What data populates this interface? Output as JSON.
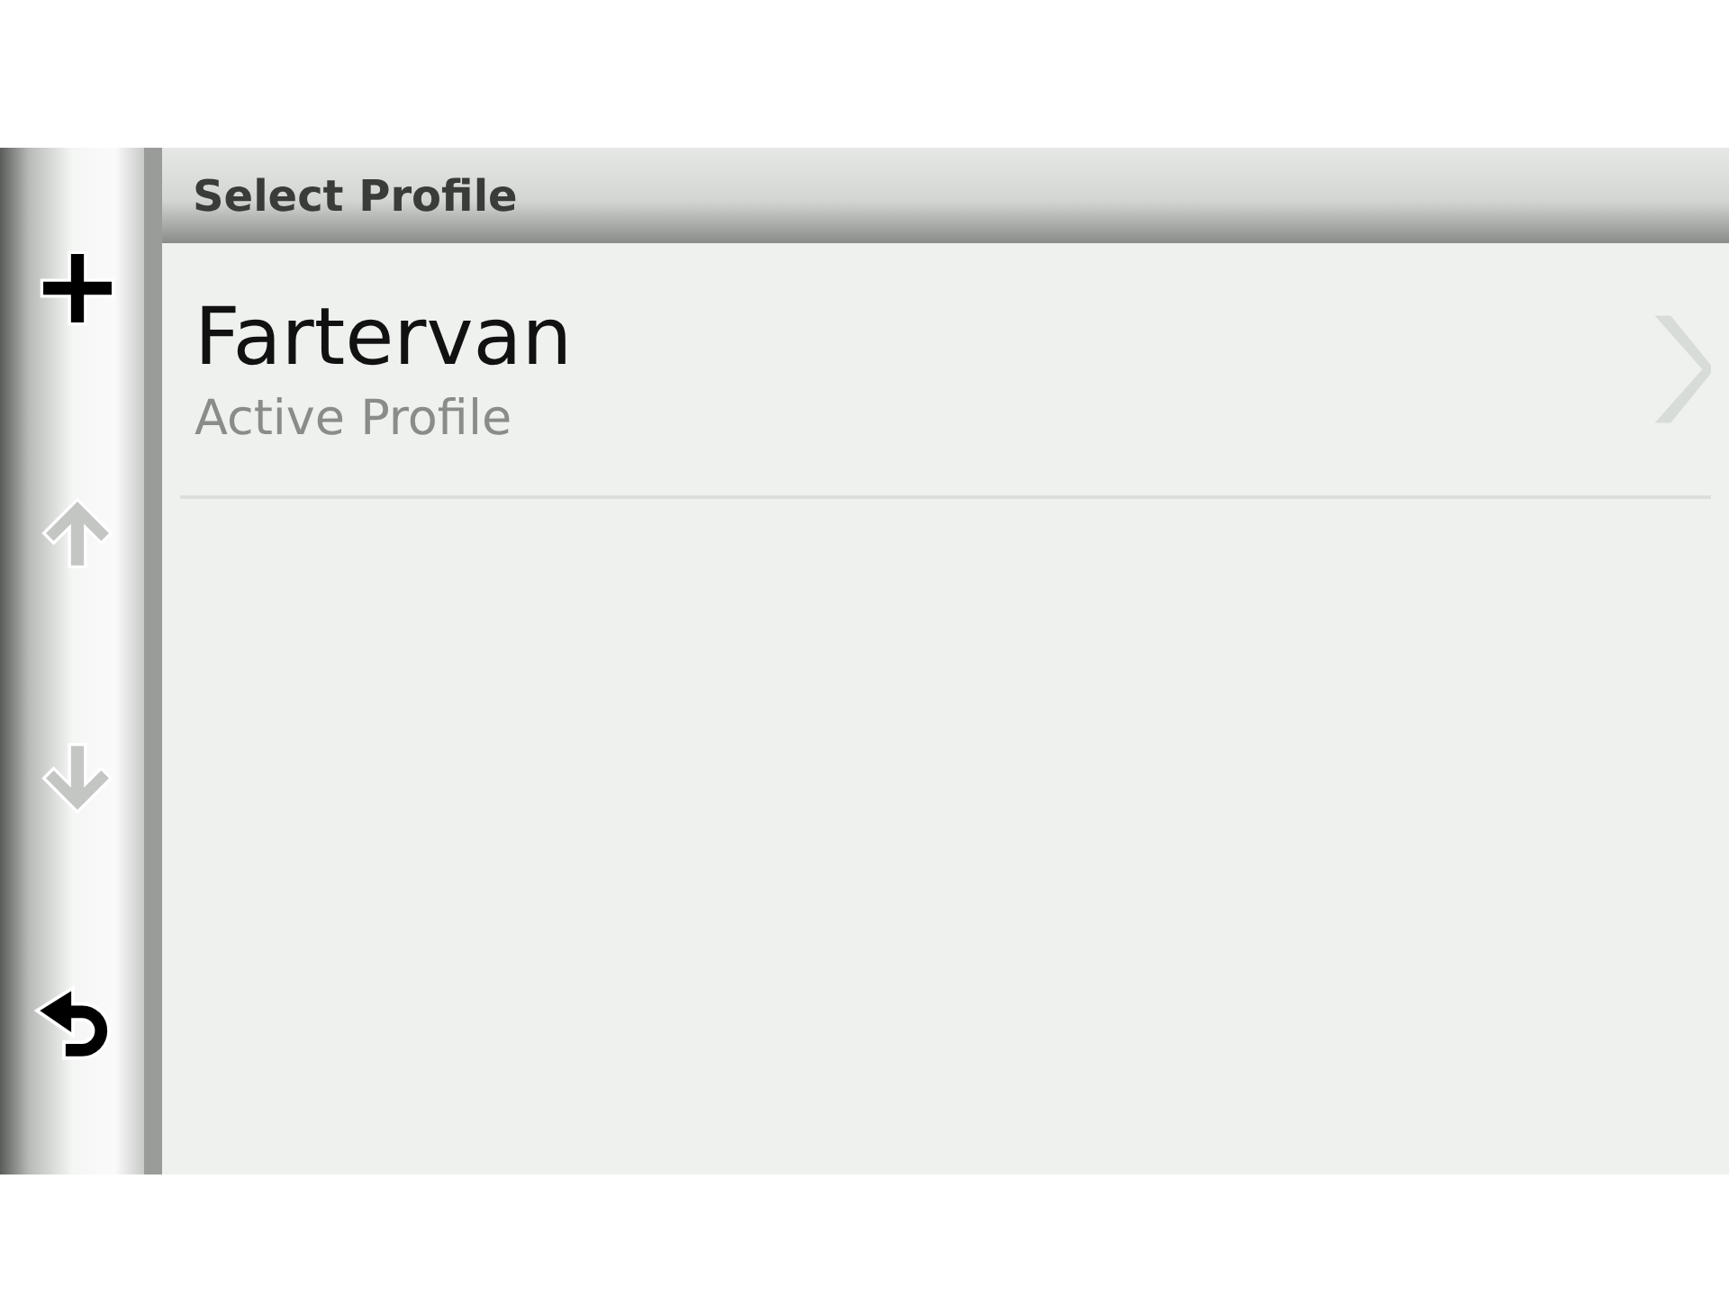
{
  "sidebar": {
    "buttons": [
      {
        "kind": "add",
        "disabled": false
      },
      {
        "kind": "up",
        "disabled": true
      },
      {
        "kind": "down",
        "disabled": true
      },
      {
        "kind": "back",
        "disabled": false
      }
    ]
  },
  "header": {
    "title": "Select Profile"
  },
  "profiles": [
    {
      "name": "Fartervan",
      "subtitle": "Active Profile"
    }
  ]
}
